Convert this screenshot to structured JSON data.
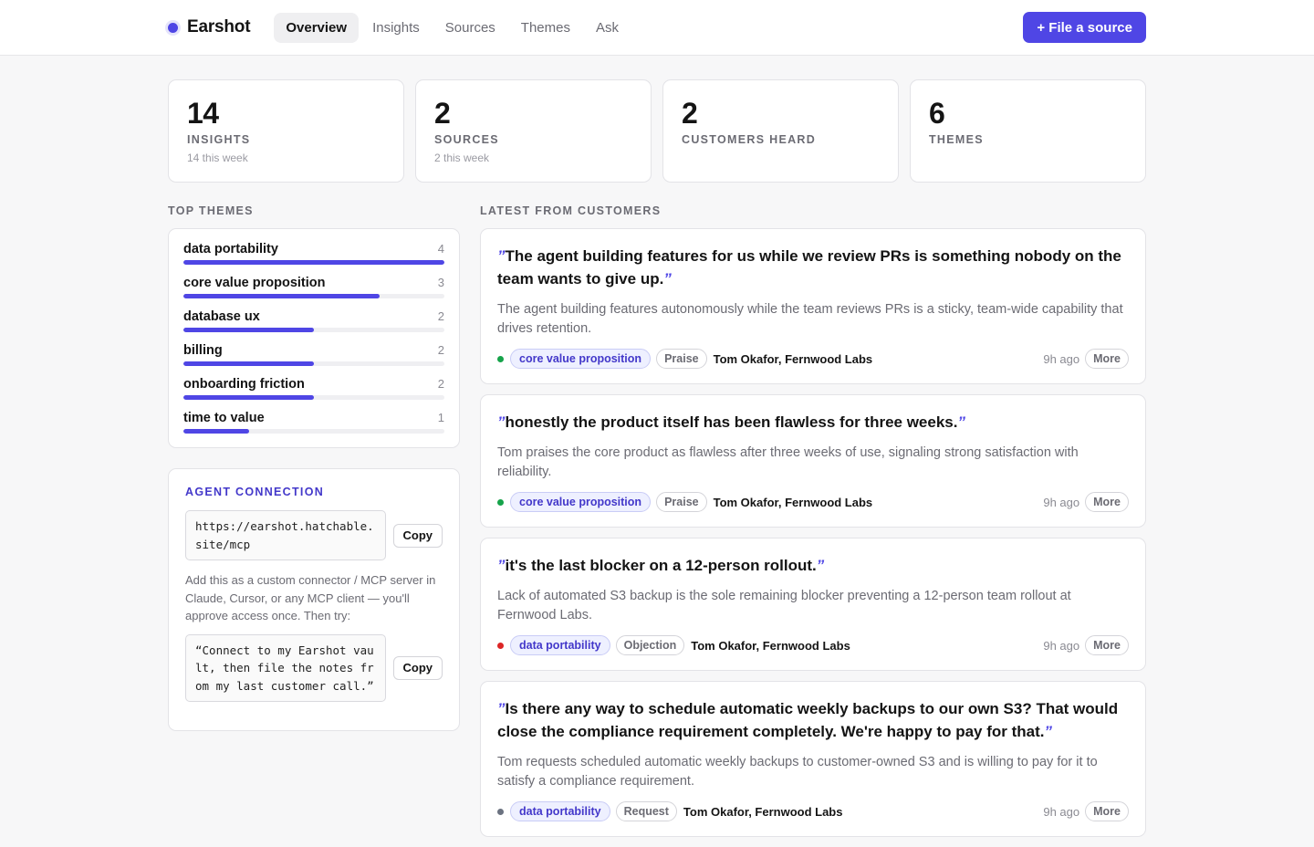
{
  "app": {
    "name": "Earshot",
    "accent": "#4f46e5"
  },
  "nav": [
    {
      "label": "Overview",
      "active": true
    },
    {
      "label": "Insights",
      "active": false
    },
    {
      "label": "Sources",
      "active": false
    },
    {
      "label": "Themes",
      "active": false
    },
    {
      "label": "Ask",
      "active": false
    }
  ],
  "primary_action": "+ File a source",
  "stats": [
    {
      "value": "14",
      "label": "Insights",
      "sub": "14 this week"
    },
    {
      "value": "2",
      "label": "Sources",
      "sub": "2 this week"
    },
    {
      "value": "2",
      "label": "Customers heard",
      "sub": ""
    },
    {
      "value": "6",
      "label": "Themes",
      "sub": ""
    }
  ],
  "top_themes": {
    "title": "Top themes",
    "max": 4,
    "items": [
      {
        "name": "data portability",
        "count": 4
      },
      {
        "name": "core value proposition",
        "count": 3
      },
      {
        "name": "database ux",
        "count": 2
      },
      {
        "name": "billing",
        "count": 2
      },
      {
        "name": "onboarding friction",
        "count": 2
      },
      {
        "name": "time to value",
        "count": 1
      }
    ]
  },
  "agent": {
    "title": "Agent connection",
    "url": "https://earshot.hatchable.site/mcp",
    "copy_label": "Copy",
    "help": "Add this as a custom connector / MCP server in Claude, Cursor, or any MCP client — you'll approve access once. Then try:",
    "prompt": "“Connect to my Earshot vault, then file the notes from my last customer call.”"
  },
  "feed": {
    "title": "Latest from customers",
    "more_label": "More",
    "items": [
      {
        "quote": "The agent building features for us while we review PRs is something nobody on the team wants to give up.",
        "summary": "The agent building features autonomously while the team reviews PRs is a sticky, team-wide capability that drives retention.",
        "sentiment_color": "#16a34a",
        "theme": "core value proposition",
        "kind": "Praise",
        "author": "Tom Okafor, Fernwood Labs",
        "time": "9h ago"
      },
      {
        "quote": "honestly the product itself has been flawless for three weeks.",
        "summary": "Tom praises the core product as flawless after three weeks of use, signaling strong satisfaction with reliability.",
        "sentiment_color": "#16a34a",
        "theme": "core value proposition",
        "kind": "Praise",
        "author": "Tom Okafor, Fernwood Labs",
        "time": "9h ago"
      },
      {
        "quote": "it's the last blocker on a 12-person rollout.",
        "summary": "Lack of automated S3 backup is the sole remaining blocker preventing a 12-person team rollout at Fernwood Labs.",
        "sentiment_color": "#dc2626",
        "theme": "data portability",
        "kind": "Objection",
        "author": "Tom Okafor, Fernwood Labs",
        "time": "9h ago"
      },
      {
        "quote": "Is there any way to schedule automatic weekly backups to our own S3? That would close the compliance requirement completely. We're happy to pay for that.",
        "summary": "Tom requests scheduled automatic weekly backups to customer-owned S3 and is willing to pay for it to satisfy a compliance requirement.",
        "sentiment_color": "#6b7280",
        "theme": "data portability",
        "kind": "Request",
        "author": "Tom Okafor, Fernwood Labs",
        "time": "9h ago"
      }
    ]
  }
}
